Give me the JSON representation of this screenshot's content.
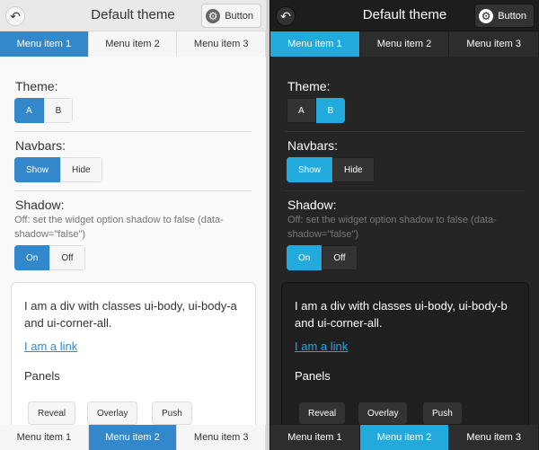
{
  "light": {
    "header": {
      "title": "Default theme",
      "button_label": "Button"
    },
    "navbar_top": [
      {
        "label": "Menu item 1"
      },
      {
        "label": "Menu item 2"
      },
      {
        "label": "Menu item 3"
      }
    ],
    "theme": {
      "label": "Theme:",
      "options": [
        "A",
        "B"
      ],
      "selected": "A"
    },
    "navbars": {
      "label": "Navbars:",
      "options": [
        "Show",
        "Hide"
      ],
      "selected": "Show"
    },
    "shadow": {
      "label": "Shadow:",
      "description": "Off: set the widget option shadow to false (data-shadow=\"false\")",
      "options": [
        "On",
        "Off"
      ],
      "selected": "On"
    },
    "card": {
      "text": "I am a div with classes ui-body, ui-body-a and ui-corner-all.",
      "link": "I am a link",
      "heading": "Panels",
      "buttons": [
        "Reveal",
        "Overlay",
        "Push"
      ]
    },
    "navbar_bottom": [
      {
        "label": "Menu item 1"
      },
      {
        "label": "Menu item 2"
      },
      {
        "label": "Menu item 3"
      }
    ]
  },
  "dark": {
    "header": {
      "title": "Default theme",
      "button_label": "Button"
    },
    "navbar_top": [
      {
        "label": "Menu item 1"
      },
      {
        "label": "Menu item 2"
      },
      {
        "label": "Menu item 3"
      }
    ],
    "theme": {
      "label": "Theme:",
      "options": [
        "A",
        "B"
      ],
      "selected": "B"
    },
    "navbars": {
      "label": "Navbars:",
      "options": [
        "Show",
        "Hide"
      ],
      "selected": "Show"
    },
    "shadow": {
      "label": "Shadow:",
      "description": "Off: set the widget option shadow to false (data-shadow=\"false\")",
      "options": [
        "On",
        "Off"
      ],
      "selected": "On"
    },
    "card": {
      "text": "I am a div with classes ui-body, ui-body-b and ui-corner-all.",
      "link": "I am a link",
      "heading": "Panels",
      "buttons": [
        "Reveal",
        "Overlay",
        "Push"
      ]
    },
    "navbar_bottom": [
      {
        "label": "Menu item 1"
      },
      {
        "label": "Menu item 2"
      },
      {
        "label": "Menu item 3"
      }
    ]
  },
  "colors": {
    "light_accent": "#3388cc",
    "dark_accent": "#22aadd",
    "light_bg": "#f9f9f9",
    "dark_bg": "#252525"
  },
  "icons": {
    "back": "back-arrow-icon",
    "gear": "gear-icon"
  }
}
